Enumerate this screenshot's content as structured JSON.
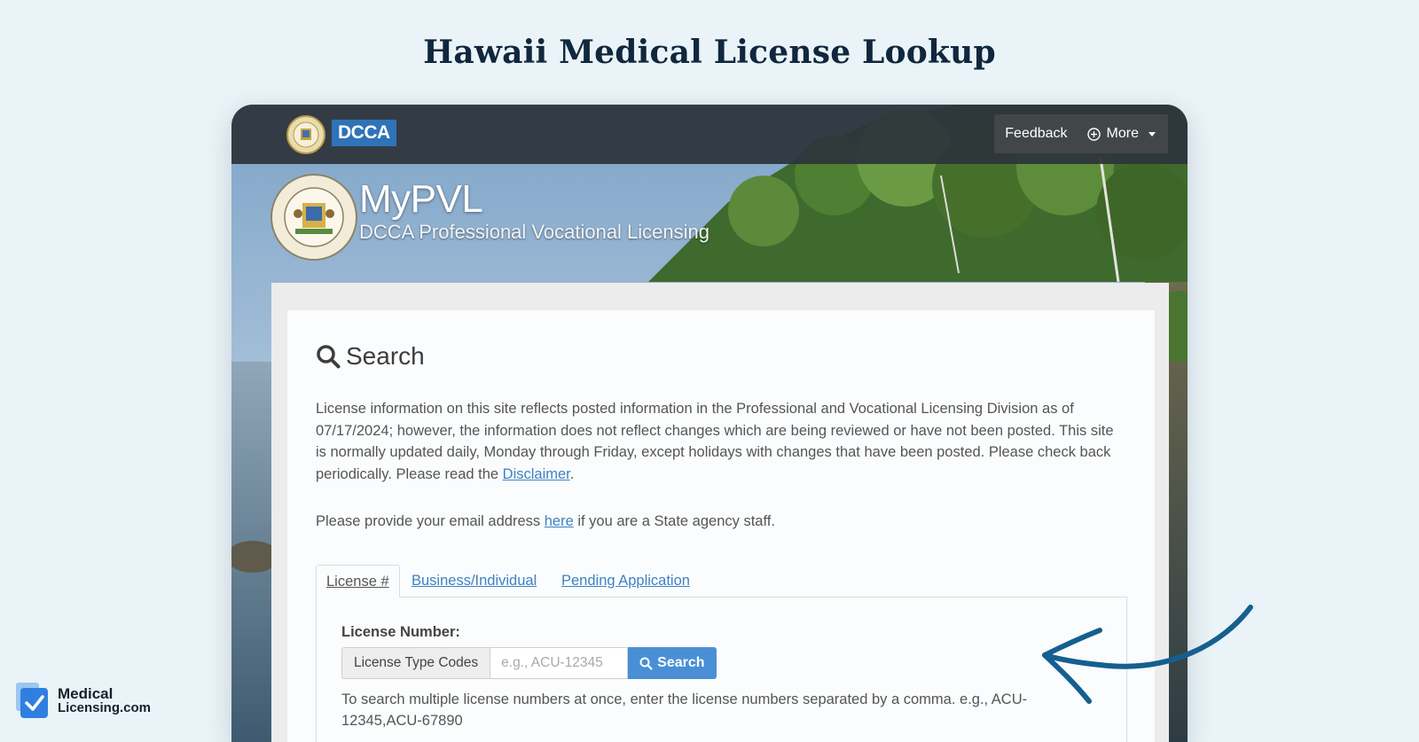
{
  "page": {
    "heading": "Hawaii Medical License Lookup"
  },
  "topbar": {
    "dcca_badge": "DCCA",
    "feedback": "Feedback",
    "more": "More",
    "icons": [
      "state-seal-icon",
      "plus-circle-icon",
      "caret-down-icon"
    ]
  },
  "branding": {
    "title": "MyPVL",
    "subtitle": "DCCA Professional Vocational Licensing"
  },
  "search": {
    "title": "Search",
    "intro_prefix": "License information on this site reflects posted information in the Professional and Vocational Licensing Division as of 07/17/2024; however, the information does not reflect changes which are being reviewed or have not been posted. This site is normally updated daily, Monday through Friday, except holidays with changes that have been posted. Please check back periodically. Please read the ",
    "disclaimer_link": "Disclaimer",
    "intro_suffix": ".",
    "email_prefix": "Please provide your email address ",
    "email_link": "here",
    "email_suffix": " if you are a State agency staff."
  },
  "tabs": [
    {
      "label": "License #",
      "active": true
    },
    {
      "label": "Business/Individual",
      "active": false
    },
    {
      "label": "Pending Application",
      "active": false
    }
  ],
  "form": {
    "label": "License Number:",
    "addon": "License Type Codes",
    "placeholder": "e.g., ACU-12345",
    "value": "",
    "button": "Search",
    "help": "To search multiple license numbers at once, enter the license numbers separated by a comma. e.g., ACU-12345,ACU-67890"
  },
  "watermark": {
    "line1": "Medical",
    "line2": "Licensing.com"
  },
  "colors": {
    "accent": "#3d82c4",
    "button": "#4a8fd6",
    "arrow": "#155f8f",
    "heading": "#10273d"
  }
}
